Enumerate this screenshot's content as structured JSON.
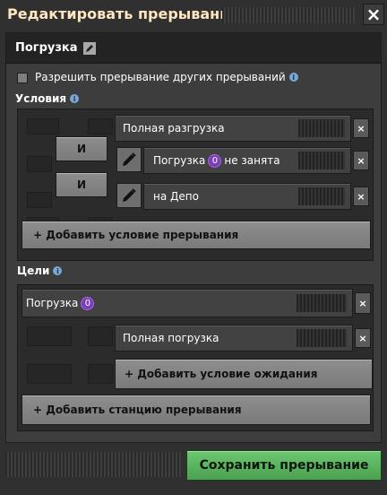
{
  "window": {
    "title": "Редактировать прерывание",
    "close_label": "×"
  },
  "interrupt_name": "Погрузка",
  "allow_interrupt_label": "Разрешить прерывание других прерываний",
  "allow_interrupt_checked": false,
  "conditions": {
    "header": "Условия",
    "and_1": "И",
    "and_2": "И",
    "rows": [
      {
        "label": "Полная разгрузка",
        "remove": "×"
      },
      {
        "label_before": "Погрузка",
        "badge": "0",
        "label_after": "не занята",
        "remove": "×"
      },
      {
        "label": "на Депо",
        "remove": "×"
      }
    ],
    "add_label": "+ Добавить условие прерывания"
  },
  "targets": {
    "header": "Цели",
    "station": {
      "label": "Погрузка",
      "badge": "0",
      "remove": "×"
    },
    "wait_row": {
      "label": "Полная погрузка",
      "remove": "×"
    },
    "add_wait_label": "+ Добавить условие ожидания",
    "add_station_label": "+ Добавить станцию прерывания"
  },
  "save_label": "Сохранить прерывание",
  "colors": {
    "accent_green": "#5eb663",
    "frame": "#313031",
    "title_text": "#ffe6c0"
  }
}
